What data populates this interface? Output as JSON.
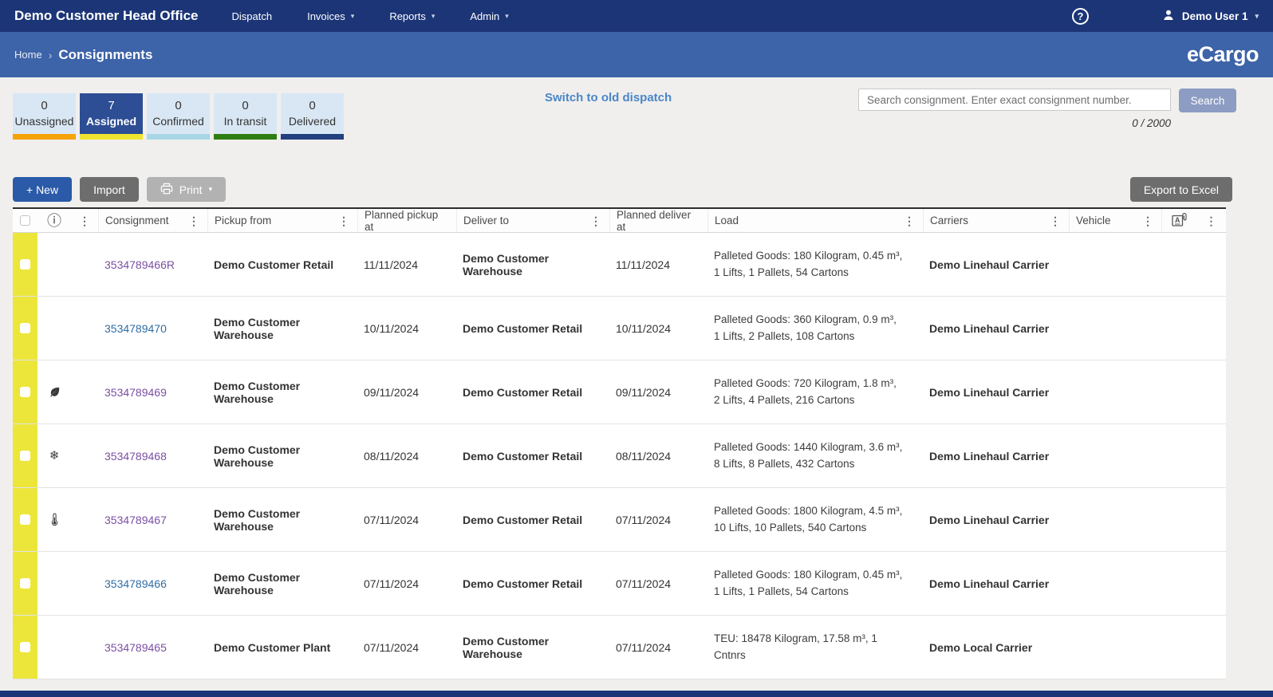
{
  "navbar": {
    "brand": "Demo Customer Head Office",
    "items": [
      {
        "label": "Dispatch",
        "caret": false
      },
      {
        "label": "Invoices",
        "caret": true
      },
      {
        "label": "Reports",
        "caret": true
      },
      {
        "label": "Admin",
        "caret": true
      }
    ],
    "help": "?",
    "user": "Demo User 1"
  },
  "breadcrumb": {
    "home": "Home",
    "separator": "›",
    "current": "Consignments",
    "logo": "eCargo"
  },
  "status_tabs": [
    {
      "count": "0",
      "label": "Unassigned",
      "accent": "#f5a409",
      "active": false
    },
    {
      "count": "7",
      "label": "Assigned",
      "accent": "#efe52e",
      "active": true
    },
    {
      "count": "0",
      "label": "Confirmed",
      "accent": "#a9d6e5",
      "active": false
    },
    {
      "count": "0",
      "label": "In transit",
      "accent": "#2e7d12",
      "active": false
    },
    {
      "count": "0",
      "label": "Delivered",
      "accent": "#223f7e",
      "active": false
    }
  ],
  "switch_link": "Switch to old dispatch",
  "search": {
    "placeholder": "Search consignment. Enter exact consignment number.",
    "button": "Search",
    "counter": "0 / 2000"
  },
  "toolbar": {
    "new_label": "+ New",
    "import_label": "Import",
    "print_label": "Print",
    "export_label": "Export to Excel"
  },
  "colors": {
    "navbar": "#1c3577",
    "breadcrumb_bar": "#3d63a8",
    "active_tab": "#2d4e94",
    "row_stripe": "#ece63b",
    "link_new": "#2f6da4",
    "link_visited": "#7a4fa3",
    "primary_button": "#2a5aa8"
  },
  "table": {
    "headers": {
      "consignment": "Consignment",
      "pickup_from": "Pickup from",
      "planned_pickup_at": "Planned pickup at",
      "deliver_to": "Deliver to",
      "planned_deliver_at": "Planned deliver at",
      "load": "Load",
      "carriers": "Carriers",
      "vehicle": "Vehicle"
    },
    "rows": [
      {
        "icon": null,
        "visited": true,
        "consignment": "3534789466R",
        "pickup_from": "Demo Customer Retail",
        "planned_pickup_at": "11/11/2024",
        "deliver_to": "Demo Customer Warehouse",
        "planned_deliver_at": "11/11/2024",
        "load": "Palleted Goods: 180 Kilogram, 0.45 m³, 1 Lifts, 1 Pallets, 54 Cartons",
        "carriers": "Demo Linehaul Carrier",
        "vehicle": ""
      },
      {
        "icon": null,
        "visited": false,
        "consignment": "3534789470",
        "pickup_from": "Demo Customer Warehouse",
        "planned_pickup_at": "10/11/2024",
        "deliver_to": "Demo Customer Retail",
        "planned_deliver_at": "10/11/2024",
        "load": "Palleted Goods: 360 Kilogram, 0.9 m³, 1 Lifts, 2 Pallets, 108 Cartons",
        "carriers": "Demo Linehaul Carrier",
        "vehicle": ""
      },
      {
        "icon": "leaf-icon",
        "visited": true,
        "consignment": "3534789469",
        "pickup_from": "Demo Customer Warehouse",
        "planned_pickup_at": "09/11/2024",
        "deliver_to": "Demo Customer Retail",
        "planned_deliver_at": "09/11/2024",
        "load": "Palleted Goods: 720 Kilogram, 1.8 m³, 2 Lifts, 4 Pallets, 216 Cartons",
        "carriers": "Demo Linehaul Carrier",
        "vehicle": ""
      },
      {
        "icon": "snowflake-icon",
        "visited": true,
        "consignment": "3534789468",
        "pickup_from": "Demo Customer Warehouse",
        "planned_pickup_at": "08/11/2024",
        "deliver_to": "Demo Customer Retail",
        "planned_deliver_at": "08/11/2024",
        "load": "Palleted Goods: 1440 Kilogram, 3.6 m³, 8 Lifts, 8 Pallets, 432 Cartons",
        "carriers": "Demo Linehaul Carrier",
        "vehicle": ""
      },
      {
        "icon": "thermometer-icon",
        "visited": true,
        "consignment": "3534789467",
        "pickup_from": "Demo Customer Warehouse",
        "planned_pickup_at": "07/11/2024",
        "deliver_to": "Demo Customer Retail",
        "planned_deliver_at": "07/11/2024",
        "load": "Palleted Goods: 1800 Kilogram, 4.5 m³, 10 Lifts, 10 Pallets, 540 Cartons",
        "carriers": "Demo Linehaul Carrier",
        "vehicle": ""
      },
      {
        "icon": null,
        "visited": false,
        "consignment": "3534789466",
        "pickup_from": "Demo Customer Warehouse",
        "planned_pickup_at": "07/11/2024",
        "deliver_to": "Demo Customer Retail",
        "planned_deliver_at": "07/11/2024",
        "load": "Palleted Goods: 180 Kilogram, 0.45 m³, 1 Lifts, 1 Pallets, 54 Cartons",
        "carriers": "Demo Linehaul Carrier",
        "vehicle": ""
      },
      {
        "icon": null,
        "visited": true,
        "consignment": "3534789465",
        "pickup_from": "Demo Customer Plant",
        "planned_pickup_at": "07/11/2024",
        "deliver_to": "Demo Customer Warehouse",
        "planned_deliver_at": "07/11/2024",
        "load": "TEU: 18478 Kilogram, 17.58 m³, 1 Cntnrs",
        "carriers": "Demo Local Carrier",
        "vehicle": ""
      }
    ]
  }
}
